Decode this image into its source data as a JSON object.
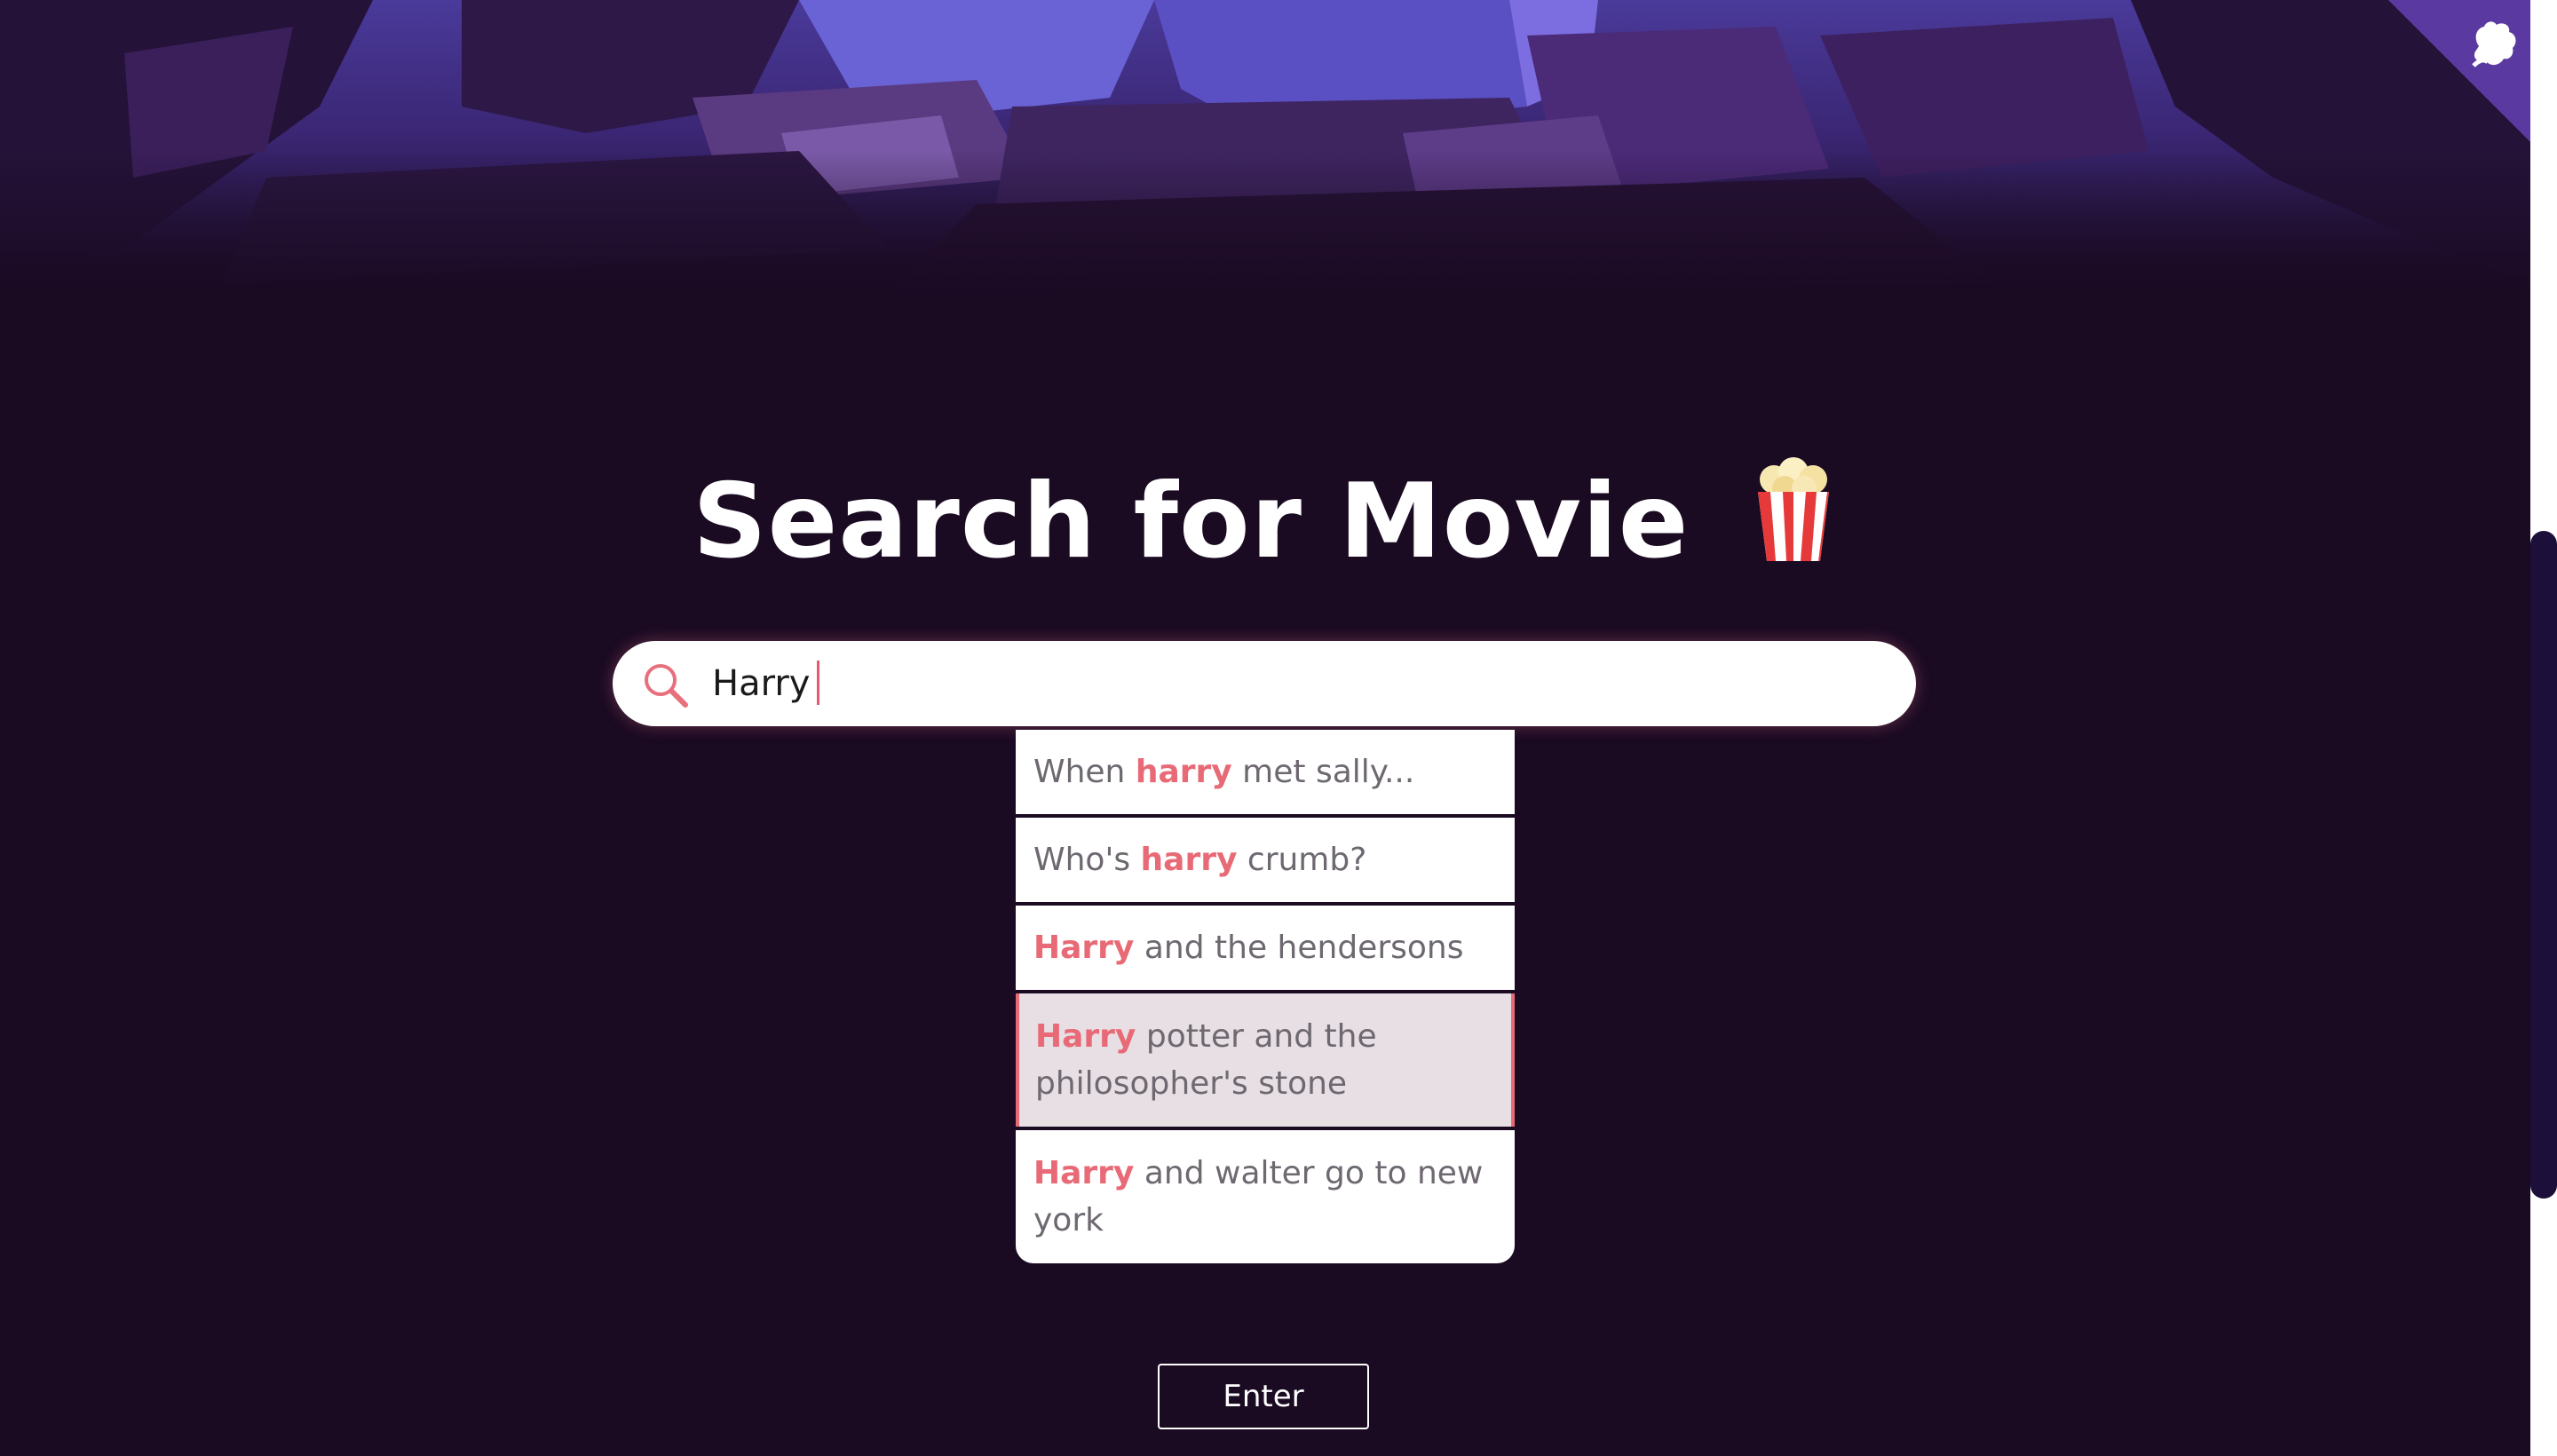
{
  "page": {
    "title": "Search for Movie",
    "title_icon": "popcorn-icon"
  },
  "search": {
    "value": "Harry",
    "icon": "search-icon"
  },
  "suggestions": [
    {
      "before": "When ",
      "match": "harry",
      "after": " met sally...",
      "active": false
    },
    {
      "before": "Who's ",
      "match": "harry",
      "after": " crumb?",
      "active": false
    },
    {
      "before": "",
      "match": "Harry",
      "after": " and the hendersons",
      "active": false
    },
    {
      "before": "",
      "match": "Harry",
      "after": " potter and the philosopher's stone",
      "active": true
    },
    {
      "before": "",
      "match": "Harry",
      "after": " and walter go to new york",
      "active": false
    }
  ],
  "actions": {
    "enter_label": "Enter"
  },
  "corner": {
    "icon": "github-cat-icon"
  },
  "colors": {
    "background": "#1a0a22",
    "accent": "#e86a76",
    "suggestion_active_bg": "#e7dfe3",
    "text_muted": "#6e6870"
  }
}
